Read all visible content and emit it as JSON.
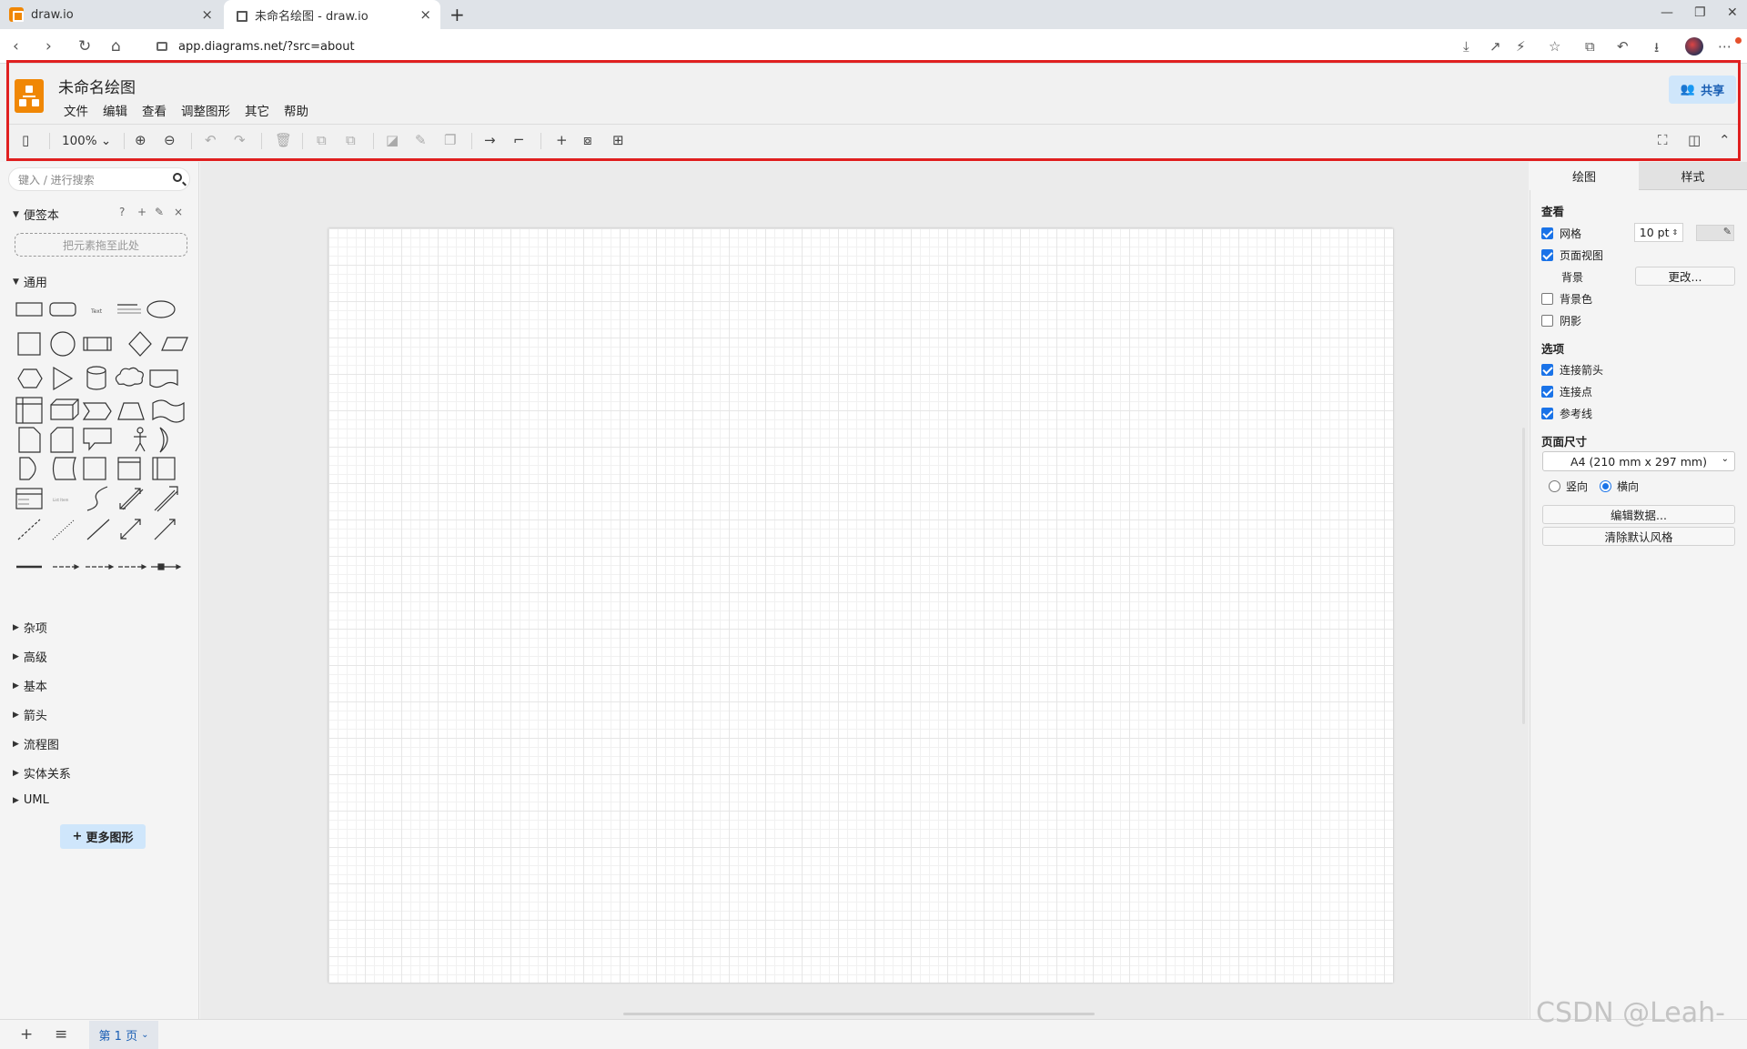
{
  "browser": {
    "tabs": [
      {
        "title": "draw.io",
        "close": "×"
      },
      {
        "title": "未命名绘图 - draw.io",
        "close": "×"
      }
    ],
    "new_tab": "+",
    "window_controls": {
      "minimize": "—",
      "restore": "❐",
      "close": "✕"
    },
    "nav": {
      "back": "‹",
      "forward": "›",
      "reload": "↻",
      "home": "⌂"
    },
    "url": "app.diagrams.net/?src=about",
    "toolbar_icons": {
      "install": "⤓",
      "share": "↗",
      "bolt": "⚡",
      "star": "☆",
      "extensions": "⧉",
      "history": "↶",
      "download": "⭳",
      "menu": "⋯"
    }
  },
  "app": {
    "title": "未命名绘图",
    "menu": [
      "文件",
      "编辑",
      "查看",
      "调整图形",
      "其它",
      "帮助"
    ],
    "share_label": "共享",
    "zoom": "100%",
    "toolbar": {
      "format_panel": "▯",
      "zoom_in": "⊕",
      "zoom_out": "⊖",
      "undo": "↶",
      "redo": "↷",
      "delete": "🗑",
      "to_front": "⧉",
      "to_back": "⧉",
      "fill": "◪",
      "line": "✎",
      "shadow": "❐",
      "connection": "→",
      "waypoints": "⌐",
      "insert": "+",
      "shapes": "⧇",
      "table": "⊞",
      "fullscreen": "⛶",
      "toggle_panel": "◫",
      "collapse": "⌃"
    }
  },
  "sidebar": {
    "search_placeholder": "键入 / 进行搜索",
    "scratchpad": {
      "label": "便签本",
      "dropzone": "把元素拖至此处",
      "icons": {
        "help": "?",
        "add": "+",
        "edit": "✎",
        "close": "×"
      }
    },
    "general_label": "通用",
    "sections": [
      "杂项",
      "高级",
      "基本",
      "箭头",
      "流程图",
      "实体关系",
      "UML"
    ],
    "more_shapes": "更多图形"
  },
  "format_panel": {
    "tabs": [
      "绘图",
      "样式"
    ],
    "view_heading": "查看",
    "grid": {
      "label": "网格",
      "checked": true,
      "size": "10 pt"
    },
    "page_view": {
      "label": "页面视图",
      "checked": true
    },
    "background": {
      "label": "背景",
      "button": "更改..."
    },
    "background_color": {
      "label": "背景色",
      "checked": false
    },
    "shadow": {
      "label": "阴影",
      "checked": false
    },
    "options_heading": "选项",
    "connection_arrows": {
      "label": "连接箭头",
      "checked": true
    },
    "connection_points": {
      "label": "连接点",
      "checked": true
    },
    "guides": {
      "label": "参考线",
      "checked": true
    },
    "page_size_heading": "页面尺寸",
    "page_size": "A4 (210 mm x 297 mm)",
    "portrait": {
      "label": "竖向",
      "checked": false
    },
    "landscape": {
      "label": "横向",
      "checked": true
    },
    "edit_data": "编辑数据...",
    "clear_style": "清除默认风格"
  },
  "bottom": {
    "add_page": "+",
    "pages_menu": "≡",
    "page_tab": "第 1 页"
  },
  "watermark": "CSDN @Leah-",
  "colors": {
    "accent": "#1a73e8",
    "brand": "#f08705",
    "highlight": "#e02020"
  }
}
